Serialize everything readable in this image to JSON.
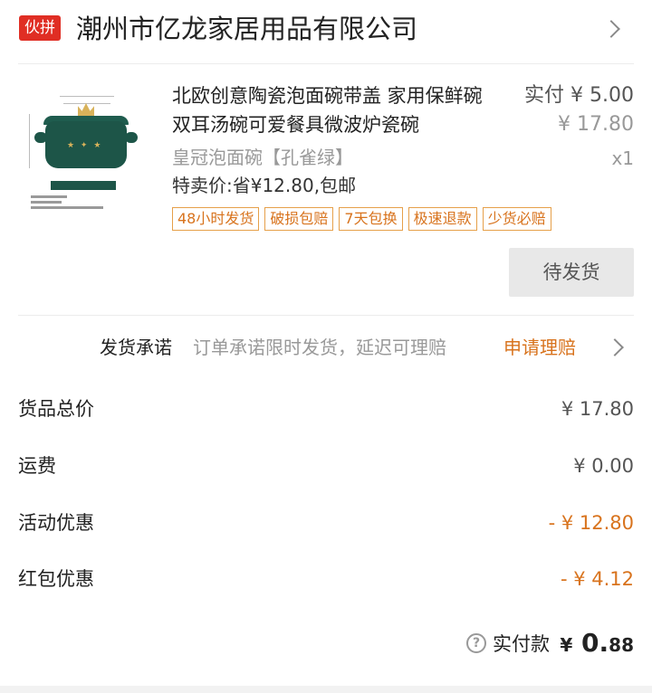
{
  "store": {
    "badge": "伙拼",
    "name": "潮州市亿龙家居用品有限公司"
  },
  "product": {
    "title": "北欧创意陶瓷泡面碗带盖 家用保鲜碗 双耳汤碗可爱餐具微波炉瓷碗",
    "paid_label": "实付 ¥ 5.00",
    "original_price": "¥ 17.80",
    "spec": "皇冠泡面碗【孔雀绿】",
    "quantity": "x1",
    "discount_note": "特卖价:省¥12.80,包邮",
    "tags": [
      "48小时发货",
      "破损包赔",
      "7天包换",
      "极速退款",
      "少货必赔"
    ],
    "status_button": "待发货"
  },
  "promise": {
    "title": "发货承诺",
    "description": "订单承诺限时发货，延迟可理赔",
    "link": "申请理赔"
  },
  "summary": [
    {
      "label": "货品总价",
      "value": "¥ 17.80",
      "accent": false
    },
    {
      "label": "运费",
      "value": "¥ 0.00",
      "accent": false
    },
    {
      "label": "活动优惠",
      "value": "- ¥ 12.80",
      "accent": true
    },
    {
      "label": "红包优惠",
      "value": "- ¥ 4.12",
      "accent": true
    }
  ],
  "total": {
    "help_symbol": "?",
    "label": "实付款",
    "currency": "¥",
    "integer": "0.",
    "decimal": "88"
  },
  "icons": {
    "store_chevron": "chevron-right-icon",
    "promise_chevron": "chevron-right-icon",
    "help": "question-circle-icon"
  },
  "colors": {
    "brand_red": "#e02e24",
    "accent_orange": "#d8731d",
    "product_green": "#1d5548"
  }
}
